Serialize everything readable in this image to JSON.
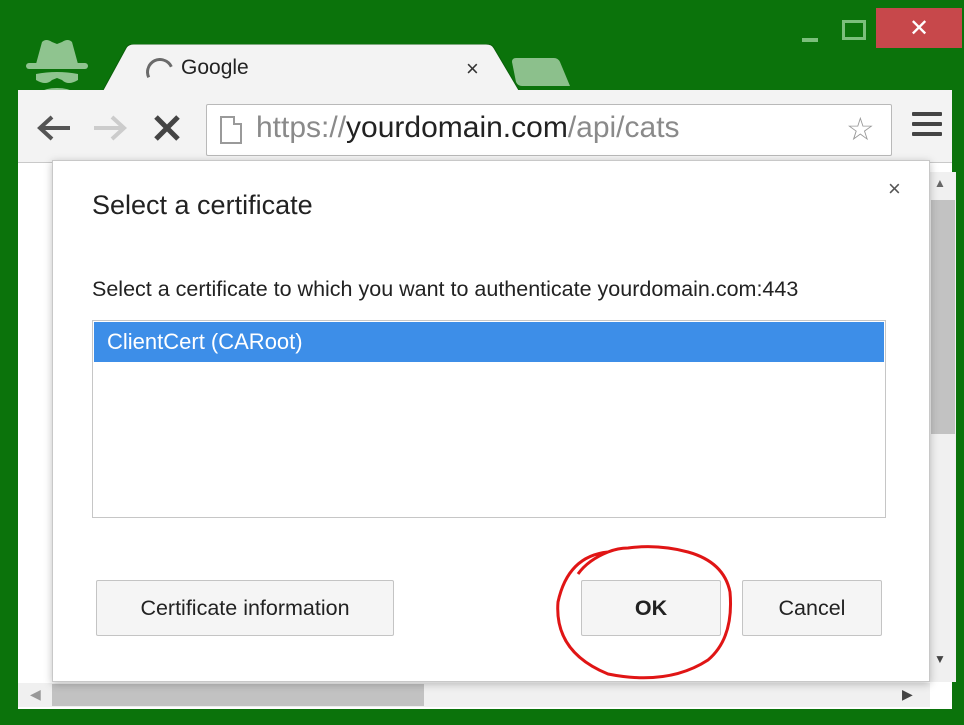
{
  "window": {
    "controls": {
      "close_glyph": "✕"
    }
  },
  "tab": {
    "title": "Google",
    "close_glyph": "×"
  },
  "toolbar": {
    "back_glyph": "🡐",
    "forward_glyph": "🡒",
    "stop_glyph": "✕",
    "url_scheme": "https://",
    "url_host": "yourdomain.com",
    "url_path": "/api/cats",
    "star_glyph": "☆"
  },
  "dialog": {
    "title": "Select a certificate",
    "close_glyph": "×",
    "description": "Select a certificate to which you want to authenticate yourdomain.com:443",
    "certificates": [
      {
        "label": "ClientCert (CARoot)",
        "selected": true
      }
    ],
    "buttons": {
      "info": "Certificate information",
      "ok": "OK",
      "cancel": "Cancel"
    }
  },
  "scrollbars": {
    "up_glyph": "▲",
    "down_glyph": "▼",
    "left_glyph": "◀",
    "right_glyph": "▶"
  },
  "colors": {
    "frame": "#0b730b",
    "selection": "#3d8ee8",
    "close_button": "#c7484b",
    "annotation": "#e01515"
  },
  "icons": {
    "incognito": "incognito-icon",
    "loading": "loading-spinner-icon",
    "page": "page-icon",
    "bookmark": "star-icon",
    "menu": "hamburger-menu-icon"
  }
}
